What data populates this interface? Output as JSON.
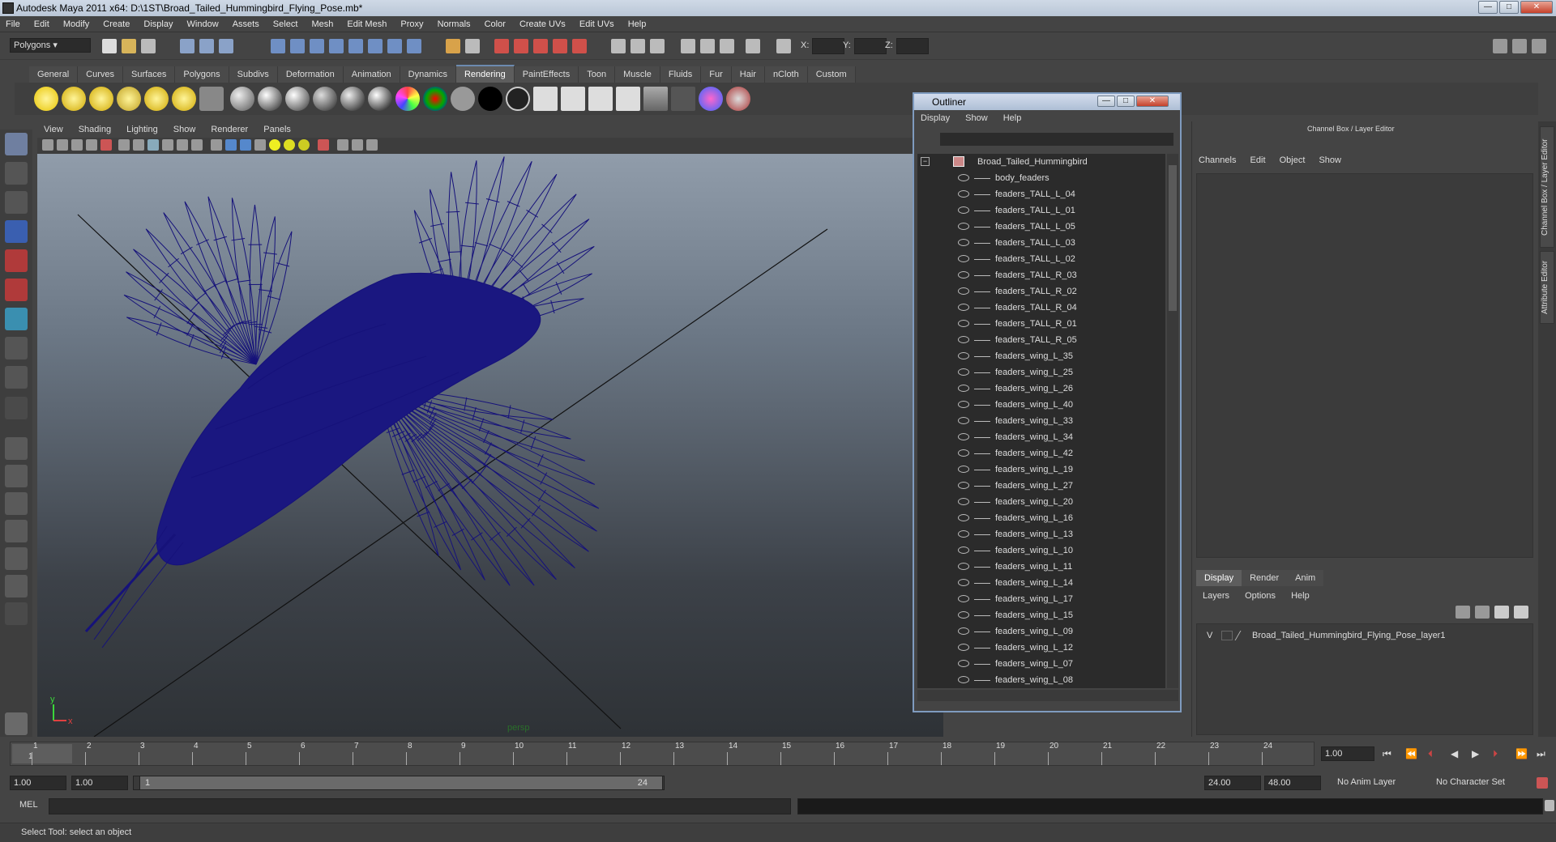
{
  "window": {
    "title": "Autodesk Maya 2011 x64: D:\\1ST\\Broad_Tailed_Hummingbird_Flying_Pose.mb*"
  },
  "menubar": [
    "File",
    "Edit",
    "Modify",
    "Create",
    "Display",
    "Window",
    "Assets",
    "Select",
    "Mesh",
    "Edit Mesh",
    "Proxy",
    "Normals",
    "Color",
    "Create UVs",
    "Edit UVs",
    "Help"
  ],
  "statusline": {
    "mode": "Polygons",
    "x_label": "X:",
    "y_label": "Y:",
    "z_label": "Z:"
  },
  "shelf_tabs": [
    "General",
    "Curves",
    "Surfaces",
    "Polygons",
    "Subdivs",
    "Deformation",
    "Animation",
    "Dynamics",
    "Rendering",
    "PaintEffects",
    "Toon",
    "Muscle",
    "Fluids",
    "Fur",
    "Hair",
    "nCloth",
    "Custom"
  ],
  "shelf_active_tab": "Rendering",
  "viewport": {
    "menu": [
      "View",
      "Shading",
      "Lighting",
      "Show",
      "Renderer",
      "Panels"
    ],
    "camera_label": "persp",
    "axis_y": "y",
    "axis_x": "x",
    "wireframe_color": "#16127a"
  },
  "outliner": {
    "title": "Outliner",
    "menu": [
      "Display",
      "Show",
      "Help"
    ],
    "root": "Broad_Tailed_Hummingbird",
    "items": [
      "body_feaders",
      "feaders_TALL_L_04",
      "feaders_TALL_L_01",
      "feaders_TALL_L_05",
      "feaders_TALL_L_03",
      "feaders_TALL_L_02",
      "feaders_TALL_R_03",
      "feaders_TALL_R_02",
      "feaders_TALL_R_04",
      "feaders_TALL_R_01",
      "feaders_TALL_R_05",
      "feaders_wing_L_35",
      "feaders_wing_L_25",
      "feaders_wing_L_26",
      "feaders_wing_L_40",
      "feaders_wing_L_33",
      "feaders_wing_L_34",
      "feaders_wing_L_42",
      "feaders_wing_L_19",
      "feaders_wing_L_27",
      "feaders_wing_L_20",
      "feaders_wing_L_16",
      "feaders_wing_L_13",
      "feaders_wing_L_10",
      "feaders_wing_L_11",
      "feaders_wing_L_14",
      "feaders_wing_L_17",
      "feaders_wing_L_15",
      "feaders_wing_L_09",
      "feaders_wing_L_12",
      "feaders_wing_L_07",
      "feaders_wing_L_08"
    ]
  },
  "channel_box": {
    "title": "Channel Box / Layer Editor",
    "menu": [
      "Channels",
      "Edit",
      "Object",
      "Show"
    ],
    "layer_tabs": [
      "Display",
      "Render",
      "Anim"
    ],
    "layer_active_tab": "Display",
    "layer_menu": [
      "Layers",
      "Options",
      "Help"
    ],
    "layer_visibility": "V",
    "layer_name": "Broad_Tailed_Hummingbird_Flying_Pose_layer1",
    "side_tabs": [
      "Channel Box / Layer Editor",
      "Attribute Editor"
    ]
  },
  "timeline": {
    "ticks": [
      "1",
      "2",
      "3",
      "4",
      "5",
      "6",
      "7",
      "8",
      "9",
      "10",
      "11",
      "12",
      "13",
      "14",
      "15",
      "16",
      "17",
      "18",
      "19",
      "20",
      "21",
      "22",
      "23",
      "24"
    ],
    "current_marker": "1",
    "current_frame": "1.00"
  },
  "range": {
    "start": "1.00",
    "playback_start": "1.00",
    "handle_start": "1",
    "handle_end": "24",
    "playback_end": "24.00",
    "end": "48.00",
    "anim_layer": "No Anim Layer",
    "character_set": "No Character Set"
  },
  "mel": {
    "label": "MEL"
  },
  "helpline": {
    "text": "Select Tool: select an object"
  }
}
